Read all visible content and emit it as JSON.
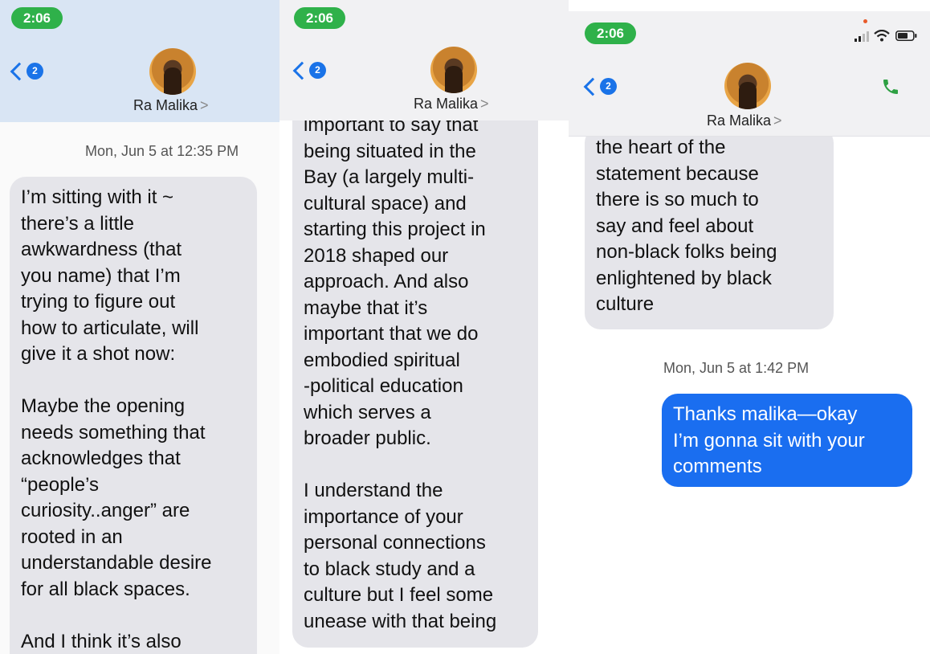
{
  "contact": {
    "name": "Ra Malika",
    "chevron": ">"
  },
  "status": {
    "time": "2:06"
  },
  "back_badge": "2",
  "icons": {
    "back": "chevron-left-icon",
    "call": "phone-icon",
    "signal": "cellular-signal-icon",
    "wifi": "wifi-icon",
    "battery": "battery-icon"
  },
  "colors": {
    "time_pill": "#2fb14a",
    "accent_blue": "#1a73e8",
    "sent_bubble": "#1a6ef0",
    "received_bubble": "#e5e5ea",
    "call_green": "#2ea043"
  },
  "panels": [
    {
      "timestamp": "Mon, Jun 5 at 12:35 PM",
      "messages": [
        {
          "direction": "received",
          "text": "I’m sitting with it ~\nthere’s a little\nawkwardness (that\nyou name) that I’m\ntrying to figure out\nhow to articulate, will\ngive it a shot now:\n\nMaybe the opening\nneeds something that\nacknowledges that\n“people’s\ncuriosity..anger” are\nrooted in an\nunderstandable desire\nfor all black spaces.\n\nAnd I think it’s also"
        }
      ]
    },
    {
      "messages": [
        {
          "direction": "received",
          "text": "important to say that\nbeing situated in the\nBay (a largely multi-\ncultural space) and\nstarting this project in\n2018 shaped our\napproach. And also\nmaybe that it’s\nimportant that we do\nembodied spiritual\n-political education\nwhich serves a\nbroader public.\n\nI understand the\nimportance of your\npersonal connections\nto black study and a\nculture but I feel some\nunease with that being"
        }
      ]
    },
    {
      "timestamp": "Mon, Jun 5 at 1:42 PM",
      "messages": [
        {
          "direction": "received",
          "text": "the heart of the\nstatement because\nthere is so much to\nsay and feel about\nnon-black folks being\nenlightened by black\nculture"
        },
        {
          "direction": "sent",
          "text": "Thanks malika—okay\nI’m gonna sit with your\ncomments"
        }
      ]
    }
  ]
}
